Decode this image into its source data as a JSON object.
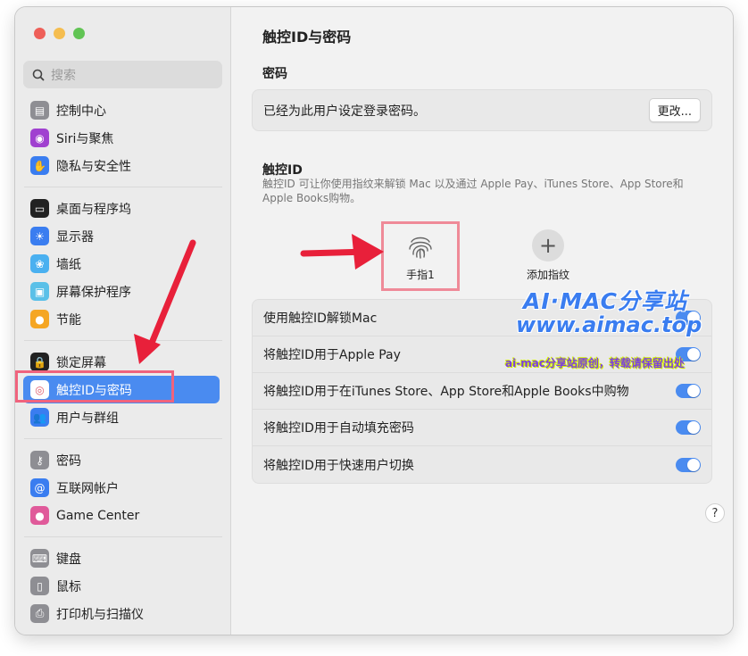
{
  "window": {
    "traffic_lights": [
      "close",
      "minimize",
      "maximize"
    ]
  },
  "search": {
    "placeholder": "搜索"
  },
  "sidebar": {
    "groups": [
      [
        {
          "label": "控制中心",
          "icon": "control-center-icon",
          "color": "#8e8e93"
        },
        {
          "label": "Siri与聚焦",
          "icon": "siri-icon",
          "color": "#a040d0"
        },
        {
          "label": "隐私与安全性",
          "icon": "hand-icon",
          "color": "#3a7df0"
        }
      ],
      [
        {
          "label": "桌面与程序坞",
          "icon": "dock-icon",
          "color": "#222222"
        },
        {
          "label": "显示器",
          "icon": "display-icon",
          "color": "#3a7df0"
        },
        {
          "label": "墙纸",
          "icon": "wallpaper-icon",
          "color": "#4ab0f0"
        },
        {
          "label": "屏幕保护程序",
          "icon": "screensaver-icon",
          "color": "#5ac0e8"
        },
        {
          "label": "节能",
          "icon": "bulb-icon",
          "color": "#f5a623"
        }
      ],
      [
        {
          "label": "锁定屏幕",
          "icon": "lock-icon",
          "color": "#222222"
        },
        {
          "label": "触控ID与密码",
          "icon": "fingerprint-icon",
          "color": "#ffffff",
          "active": true
        },
        {
          "label": "用户与群组",
          "icon": "users-icon",
          "color": "#3a7df0"
        }
      ],
      [
        {
          "label": "密码",
          "icon": "key-icon",
          "color": "#8e8e93"
        },
        {
          "label": "互联网帐户",
          "icon": "at-icon",
          "color": "#3a7df0"
        },
        {
          "label": "Game Center",
          "icon": "game-center-icon",
          "color": "#e05a9a"
        }
      ],
      [
        {
          "label": "键盘",
          "icon": "keyboard-icon",
          "color": "#8e8e93"
        },
        {
          "label": "鼠标",
          "icon": "mouse-icon",
          "color": "#8e8e93"
        },
        {
          "label": "打印机与扫描仪",
          "icon": "printer-icon",
          "color": "#8e8e93"
        }
      ]
    ]
  },
  "main": {
    "title": "触控ID与密码",
    "password_section": {
      "title": "密码",
      "status": "已经为此用户设定登录密码。",
      "change_button": "更改..."
    },
    "touchid_section": {
      "title": "触控ID",
      "description": "触控ID 可让你使用指纹来解锁 Mac 以及通过 Apple Pay、iTunes Store、App Store和 Apple Books购物。",
      "finger_label": "手指1",
      "add_label": "添加指纹"
    },
    "toggles": [
      {
        "label": "使用触控ID解锁Mac",
        "on": true
      },
      {
        "label": "将触控ID用于Apple Pay",
        "on": true
      },
      {
        "label": "将触控ID用于在iTunes Store、App Store和Apple Books中购物",
        "on": true
      },
      {
        "label": "将触控ID用于自动填充密码",
        "on": true
      },
      {
        "label": "将触控ID用于快速用户切换",
        "on": true
      }
    ],
    "help": "?"
  },
  "watermark": {
    "line1": "AI·MAC分享站",
    "line2": "www.aimac.top",
    "line3": "ai-mac分享站原创，转载请保留出处"
  },
  "colors": {
    "accent": "#4a8bf0",
    "annotation": "#e8203a"
  }
}
